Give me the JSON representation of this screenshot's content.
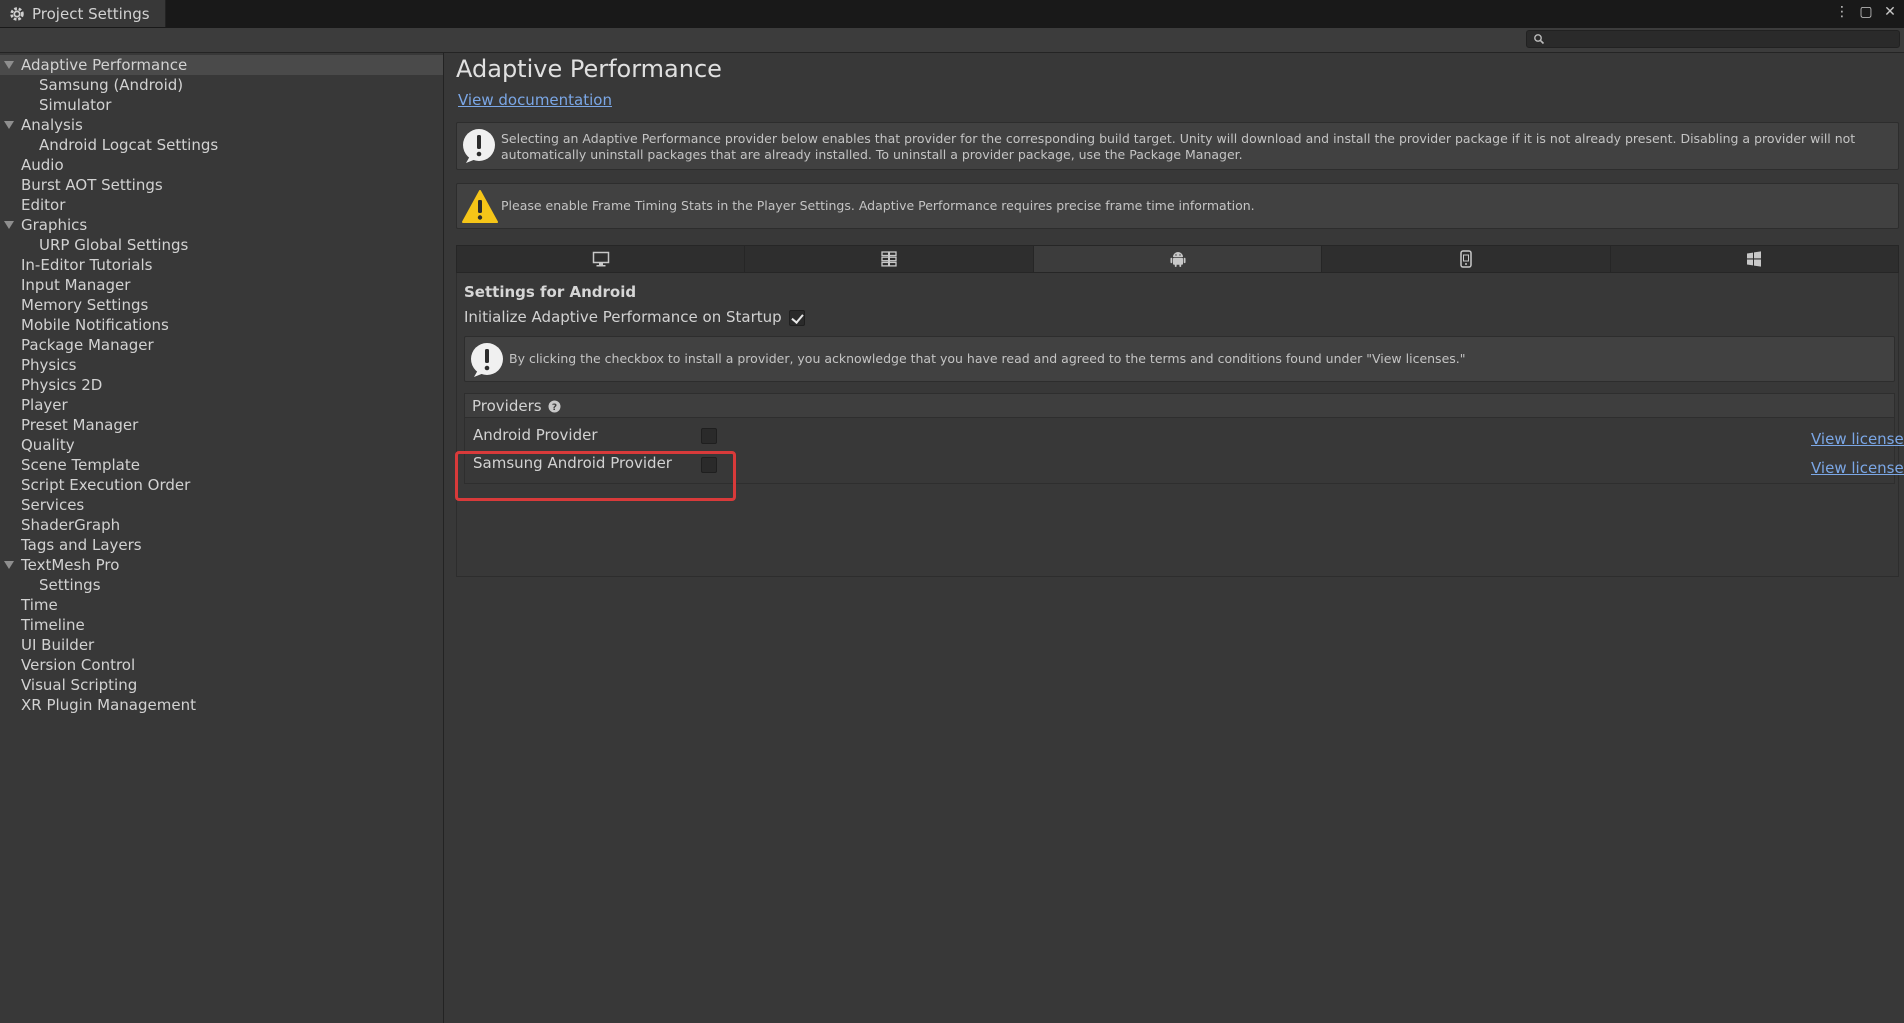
{
  "window": {
    "tab_title": "Project Settings",
    "controls": [
      "more-icon",
      "maximize-icon",
      "close-icon"
    ]
  },
  "search": {
    "placeholder": "",
    "value": ""
  },
  "sidebar": {
    "items": [
      {
        "label": "Adaptive Performance",
        "expanded": true,
        "selected": true,
        "depth": 0
      },
      {
        "label": "Samsung (Android)",
        "depth": 1
      },
      {
        "label": "Simulator",
        "depth": 1
      },
      {
        "label": "Analysis",
        "expanded": true,
        "depth": 0
      },
      {
        "label": "Android Logcat Settings",
        "depth": 1
      },
      {
        "label": "Audio",
        "depth": 0
      },
      {
        "label": "Burst AOT Settings",
        "depth": 0
      },
      {
        "label": "Editor",
        "depth": 0
      },
      {
        "label": "Graphics",
        "expanded": true,
        "depth": 0
      },
      {
        "label": "URP Global Settings",
        "depth": 1
      },
      {
        "label": "In-Editor Tutorials",
        "depth": 0
      },
      {
        "label": "Input Manager",
        "depth": 0
      },
      {
        "label": "Memory Settings",
        "depth": 0
      },
      {
        "label": "Mobile Notifications",
        "depth": 0
      },
      {
        "label": "Package Manager",
        "depth": 0
      },
      {
        "label": "Physics",
        "depth": 0
      },
      {
        "label": "Physics 2D",
        "depth": 0
      },
      {
        "label": "Player",
        "depth": 0
      },
      {
        "label": "Preset Manager",
        "depth": 0
      },
      {
        "label": "Quality",
        "depth": 0
      },
      {
        "label": "Scene Template",
        "depth": 0
      },
      {
        "label": "Script Execution Order",
        "depth": 0
      },
      {
        "label": "Services",
        "depth": 0
      },
      {
        "label": "ShaderGraph",
        "depth": 0
      },
      {
        "label": "Tags and Layers",
        "depth": 0
      },
      {
        "label": "TextMesh Pro",
        "expanded": true,
        "depth": 0
      },
      {
        "label": "Settings",
        "depth": 1
      },
      {
        "label": "Time",
        "depth": 0
      },
      {
        "label": "Timeline",
        "depth": 0
      },
      {
        "label": "UI Builder",
        "depth": 0
      },
      {
        "label": "Version Control",
        "depth": 0
      },
      {
        "label": "Visual Scripting",
        "depth": 0
      },
      {
        "label": "XR Plugin Management",
        "depth": 0
      }
    ]
  },
  "main": {
    "title": "Adaptive Performance",
    "doc_link": "View documentation",
    "info_text": "Selecting an Adaptive Performance provider below enables that provider for the corresponding build target. Unity will download and install the provider package if it is not already present. Disabling a provider will not automatically uninstall packages that are already installed. To uninstall a provider package, use the Package Manager.",
    "warning_text": "Please enable Frame Timing Stats in the Player Settings. Adaptive Performance requires precise frame time information.",
    "platform_tabs": [
      {
        "icon": "desktop-icon",
        "active": false
      },
      {
        "icon": "dedicated-server-icon",
        "active": false
      },
      {
        "icon": "android-icon",
        "active": true
      },
      {
        "icon": "ios-icon",
        "active": false
      },
      {
        "icon": "windows-icon",
        "active": false
      }
    ],
    "section_title": "Settings for Android",
    "init_label": "Initialize Adaptive Performance on Startup",
    "init_checked": true,
    "license_notice": "By clicking the checkbox to install a provider, you acknowledge that you have read and agreed to the terms and conditions found under \"View licenses.\"",
    "providers_label": "Providers",
    "providers": [
      {
        "label": "Android Provider",
        "checked": false,
        "link": "View licenses"
      },
      {
        "label": "Samsung Android Provider",
        "checked": false,
        "link": "View licenses"
      }
    ]
  },
  "colors": {
    "background": "#383838",
    "link": "#7ba7e6",
    "highlight": "#d83a3a",
    "warning": "#f5c518"
  }
}
